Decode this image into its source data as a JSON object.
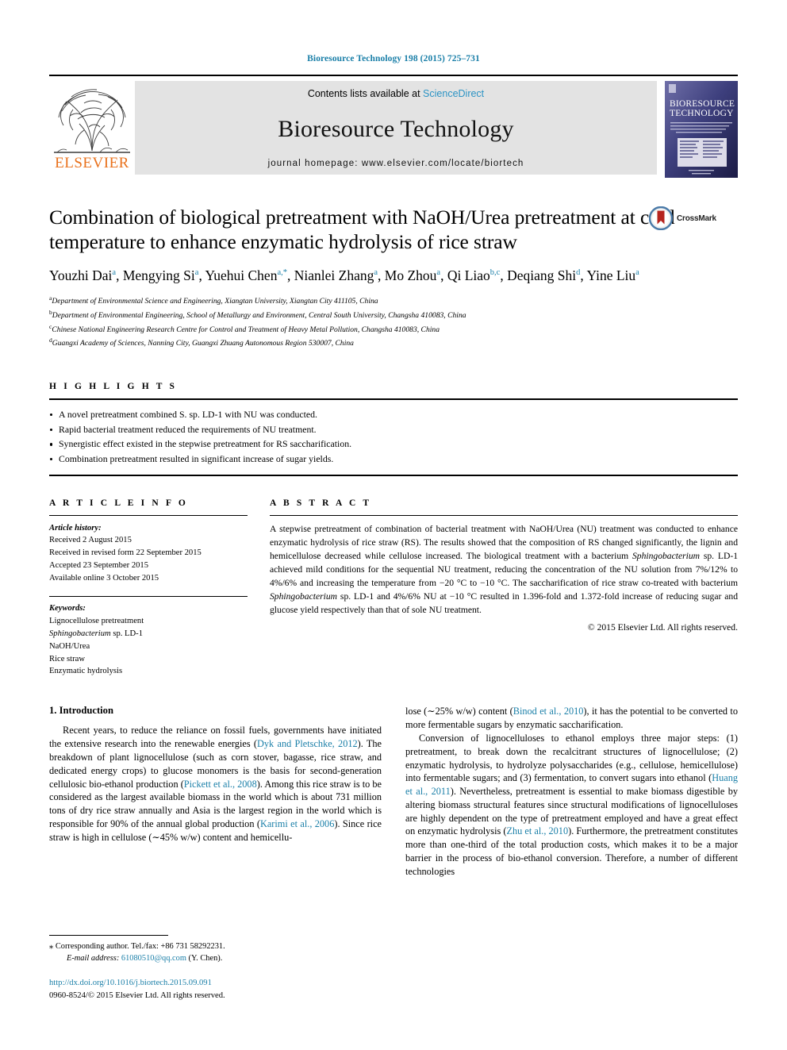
{
  "running_head": "Bioresource Technology 198 (2015) 725–731",
  "masthead": {
    "contents_prefix": "Contents lists available at",
    "sciencedirect": "ScienceDirect",
    "journal_name": "Bioresource Technology",
    "homepage": "journal homepage: www.elsevier.com/locate/biortech",
    "publisher_wordmark": "ELSEVIER",
    "cover_title_line1": "BIORESOURCE",
    "cover_title_line2": "TECHNOLOGY"
  },
  "article": {
    "title": "Combination of biological pretreatment with NaOH/Urea pretreatment at cold temperature to enhance enzymatic hydrolysis of rice straw",
    "crossmark_label": "CrossMark",
    "authors": [
      {
        "name": "Youzhi Dai",
        "sup": "a",
        "sep": ", "
      },
      {
        "name": "Mengying Si",
        "sup": "a",
        "sep": ", "
      },
      {
        "name": "Yuehui Chen",
        "sup": "a,*",
        "sep": ", "
      },
      {
        "name": "Nianlei Zhang",
        "sup": "a",
        "sep": ", "
      },
      {
        "name": "Mo Zhou",
        "sup": "a",
        "sep": ", "
      },
      {
        "name": "Qi Liao",
        "sup": "b,c",
        "sep": ", "
      },
      {
        "name": "Deqiang Shi",
        "sup": "d",
        "sep": ", "
      },
      {
        "name": "Yine Liu",
        "sup": "a",
        "sep": ""
      }
    ],
    "affiliations": [
      {
        "mark": "a",
        "text": "Department of Environmental Science and Engineering, Xiangtan University, Xiangtan City 411105, China"
      },
      {
        "mark": "b",
        "text": "Department of Environmental Engineering, School of Metallurgy and Environment, Central South University, Changsha 410083, China"
      },
      {
        "mark": "c",
        "text": "Chinese National Engineering Research Centre for Control and Treatment of Heavy Metal Pollution, Changsha 410083, China"
      },
      {
        "mark": "d",
        "text": "Guangxi Academy of Sciences, Nanning City, Guangxi Zhuang Autonomous Region 530007, China"
      }
    ]
  },
  "highlights": {
    "heading": "H I G H L I G H T S",
    "items": [
      "A novel pretreatment combined S. sp. LD-1 with NU was conducted.",
      "Rapid bacterial treatment reduced the requirements of NU treatment.",
      "Synergistic effect existed in the stepwise pretreatment for RS saccharification.",
      "Combination pretreatment resulted in significant increase of sugar yields."
    ]
  },
  "article_info": {
    "heading": "A R T I C L E    I N F O",
    "history_label": "Article history:",
    "history": [
      "Received 2 August 2015",
      "Received in revised form 22 September 2015",
      "Accepted 23 September 2015",
      "Available online 3 October 2015"
    ],
    "keywords_label": "Keywords:",
    "keywords": [
      "Lignocellulose pretreatment",
      "Sphingobacterium sp. LD-1",
      "NaOH/Urea",
      "Rice straw",
      "Enzymatic hydrolysis"
    ]
  },
  "abstract": {
    "heading": "A B S T R A C T",
    "text_part1": "A stepwise pretreatment of combination of bacterial treatment with NaOH/Urea (NU) treatment was conducted to enhance enzymatic hydrolysis of rice straw (RS). The results showed that the composition of RS changed significantly, the lignin and hemicellulose decreased while cellulose increased. The biological treatment with a bacterium ",
    "italic1": "Sphingobacterium",
    "text_part2": " sp. LD-1 achieved mild conditions for the sequential NU treatment, reducing the concentration of the NU solution from 7%/12% to 4%/6% and increasing the temperature from −20 °C to −10 °C. The saccharification of rice straw co-treated with bacterium ",
    "italic2": "Sphingobacterium",
    "text_part3": " sp. LD-1 and 4%/6% NU at −10 °C resulted in 1.396-fold and 1.372-fold increase of reducing sugar and glucose yield respectively than that of sole NU treatment.",
    "copyright": "© 2015 Elsevier Ltd. All rights reserved."
  },
  "introduction": {
    "section_title": "1. Introduction",
    "left_paragraph_1_a": "Recent years, to reduce the reliance on fossil fuels, governments have initiated the extensive research into the renewable energies (",
    "ref1": "Dyk and Pletschke, 2012",
    "left_paragraph_1_b": "). The breakdown of plant lignocellulose (such as corn stover, bagasse, rice straw, and dedicated energy crops) to glucose monomers is the basis for second-generation cellulosic bio-ethanol production (",
    "ref2": "Pickett et al., 2008",
    "left_paragraph_1_c": "). Among this rice straw is to be considered as the largest available biomass in the world which is about 731 million tons of dry rice straw annually and Asia is the largest region in the world which is responsible for 90% of the annual global production (",
    "ref3": "Karimi et al., 2006",
    "left_paragraph_1_d": "). Since rice straw is high in cellulose (∼45% w/w) content and hemicellu-",
    "right_paragraph_1_a": "lose (∼25% w/w) content (",
    "ref4": "Binod et al., 2010",
    "right_paragraph_1_b": "), it has the potential to be converted to more fermentable sugars by enzymatic saccharification.",
    "right_paragraph_2_a": "Conversion of lignocelluloses to ethanol employs three major steps: (1) pretreatment, to break down the recalcitrant structures of lignocellulose; (2) enzymatic hydrolysis, to hydrolyze polysaccharides (e.g., cellulose, hemicellulose) into fermentable sugars; and (3) fermentation, to convert sugars into ethanol (",
    "ref5": "Huang et al., 2011",
    "right_paragraph_2_b": "). Nevertheless, pretreatment is essential to make biomass digestible by altering biomass structural features since structural modifications of lignocelluloses are highly dependent on the type of pretreatment employed and have a great effect on enzymatic hydrolysis (",
    "ref6": "Zhu et al., 2010",
    "right_paragraph_2_c": "). Furthermore, the pretreatment constitutes more than one-third of the total production costs, which makes it to be a major barrier in the process of bio-ethanol conversion. Therefore, a number of different technologies"
  },
  "footer": {
    "corresponding_marker": "⁎",
    "corresponding_text": "Corresponding author. Tel./fax: +86 731 58292231.",
    "email_label": "E-mail address:",
    "email": "61080510@qq.com",
    "email_suffix": "(Y. Chen).",
    "doi": "http://dx.doi.org/10.1016/j.biortech.2015.09.091",
    "issn_line": "0960-8524/© 2015 Elsevier Ltd. All rights reserved."
  },
  "colors": {
    "link_blue": "#1a7fa8",
    "sciencedirect_blue": "#2b93c4",
    "elsevier_orange": "#E9711C",
    "masthead_gray": "#e3e3e3"
  }
}
